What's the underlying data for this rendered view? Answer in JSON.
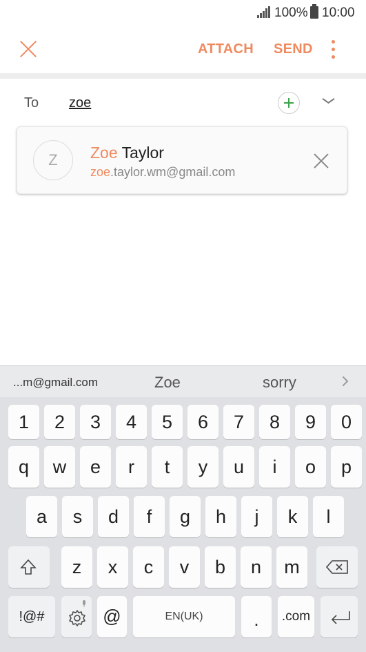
{
  "status_bar": {
    "battery": "100%",
    "time": "10:00"
  },
  "app_bar": {
    "attach_label": "ATTACH",
    "send_label": "SEND"
  },
  "recipient": {
    "to_label": "To",
    "input_value": "zoe"
  },
  "suggestion": {
    "avatar_initial": "Z",
    "name_match": "Zoe",
    "name_rest": " Taylor",
    "email_match": "zoe",
    "email_rest": ".taylor.wm@gmail.com"
  },
  "keyboard": {
    "predictions": [
      "...m@gmail.com",
      "Zoe",
      "sorry"
    ],
    "row_numbers": [
      "1",
      "2",
      "3",
      "4",
      "5",
      "6",
      "7",
      "8",
      "9",
      "0"
    ],
    "row_top": [
      "q",
      "w",
      "e",
      "r",
      "t",
      "y",
      "u",
      "i",
      "o",
      "p"
    ],
    "row_mid": [
      "a",
      "s",
      "d",
      "f",
      "g",
      "h",
      "j",
      "k",
      "l"
    ],
    "row_bottom": [
      "z",
      "x",
      "c",
      "v",
      "b",
      "n",
      "m"
    ],
    "symbols_label": "!@#",
    "at_label": "@",
    "space_label": "EN(UK)",
    "period_label": ".",
    "com_label": ".com"
  },
  "colors": {
    "accent": "#ef8a5f",
    "add_green": "#3aa34a"
  }
}
